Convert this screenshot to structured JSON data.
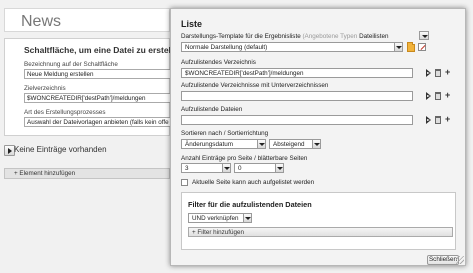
{
  "background": {
    "page_heading": "News",
    "panel_title": "Schaltfläche, um eine Datei zu erstellen",
    "fields": [
      {
        "label": "Bezeichnung auf der Schaltfläche",
        "value": "Neue Meldung erstellen"
      },
      {
        "label": "Zielverzeichnis",
        "value": "$WONCREATEDIR['destPath']/meldungen"
      },
      {
        "label": "Art des Erstellungsprozesses",
        "value": "Auswahl der Dateivorlagen anbieten (falls kein offe"
      }
    ],
    "no_entries_text": "Keine Einträge vorhanden",
    "add_element_label": "+ Element hinzufügen"
  },
  "dialog": {
    "title": "Liste",
    "template_label": "Darstellungs-Template für die Ergebnisliste",
    "template_label_hint": "(Angebotene Typen",
    "template_type_value": "Dateilisten",
    "template_value": "Normale Darstellung (default)",
    "directory_label": "Aufzulistendes Verzeichnis",
    "directory_value": "$WONCREATEDIR['destPath']/meldungen",
    "subdirs_label": "Aufzulistende Verzeichnisse mit Unterverzeichnissen",
    "subdirs_value": "",
    "files_label": "Aufzulistende Dateien",
    "files_value": "",
    "sort_label": "Sortieren nach / Sortierrichtung",
    "sort_by": "Änderungsdatum",
    "sort_dir": "Absteigend",
    "paging_label": "Anzahl Einträge pro Seite / blätterbare Seiten",
    "per_page": "3",
    "pages": "0",
    "current_page_checkbox_label": "Aktuelle Seite kann auch aufgelistet werden",
    "current_page_checked": false,
    "filter_title": "Filter für die aufzulistenden Dateien",
    "filter_combine": "UND verknüpfen",
    "filter_add_label": "+ Filter hinzufügen",
    "close_label": "Schließen"
  }
}
